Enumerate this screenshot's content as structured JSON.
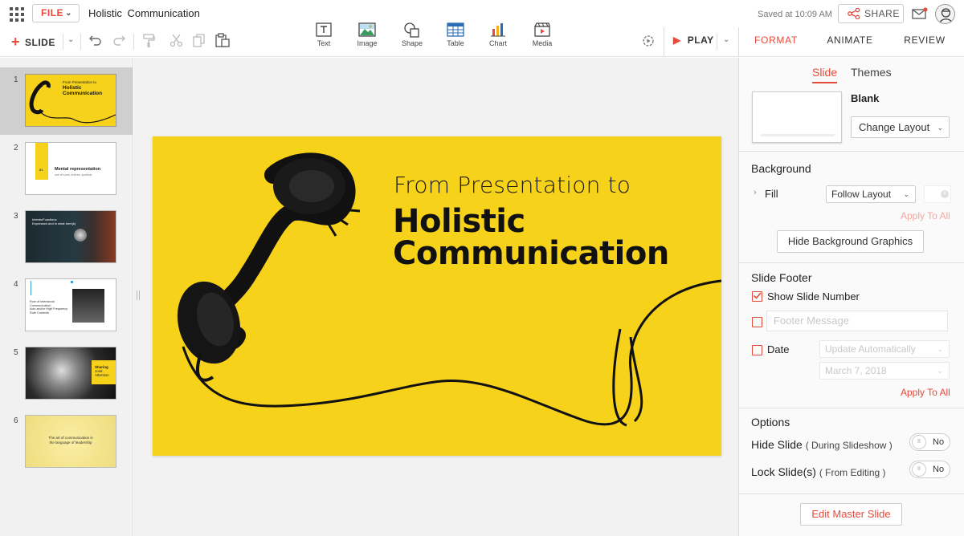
{
  "topbar": {
    "file_label": "FILE",
    "document_title": "Holistic  Communication",
    "saved_status": "Saved at 10:09 AM",
    "share_label": "SHARE"
  },
  "toolbar": {
    "slide_label": "SLIDE",
    "insert_items": [
      {
        "label": "Text",
        "icon": "text-box-icon"
      },
      {
        "label": "Image",
        "icon": "image-icon"
      },
      {
        "label": "Shape",
        "icon": "shape-icon"
      },
      {
        "label": "Table",
        "icon": "table-icon"
      },
      {
        "label": "Chart",
        "icon": "bar-chart-icon"
      },
      {
        "label": "Media",
        "icon": "media-icon"
      }
    ],
    "play_label": "PLAY"
  },
  "right_tabs": [
    {
      "label": "FORMAT",
      "active": true
    },
    {
      "label": "ANIMATE",
      "active": false
    },
    {
      "label": "REVIEW",
      "active": false
    }
  ],
  "colors": {
    "accent": "#e64a3b",
    "slide_bg": "#f7d21a",
    "disabled_link": "#f2a79e"
  },
  "thumbnails": [
    {
      "number": "1",
      "line1": "From Presentation to",
      "line2": "Holistic",
      "line3": "Communication"
    },
    {
      "number": "2",
      "badge": "01",
      "heading": "Mental representation",
      "sub": "use of icons, indices, symbols"
    },
    {
      "number": "3",
      "line1": "Intents/Functions",
      "line2": "Expressed and in what form(s)"
    },
    {
      "number": "4",
      "line1": "Role of Intentional",
      "line2": "Communication",
      "line3": "Acts and/or High Frequency",
      "line4": "Rote Contexts"
    },
    {
      "number": "5",
      "line1": "Sharing",
      "line2": "Joint",
      "line3": "Attention"
    },
    {
      "number": "6",
      "line1": "The art of communication is",
      "line2": "the language of leadership"
    }
  ],
  "slide": {
    "subtitle": "From Presentation to",
    "title_line1": "Holistic",
    "title_line2": "Communication"
  },
  "format_panel": {
    "subtabs": [
      "Slide",
      "Themes"
    ],
    "layout_name": "Blank",
    "change_layout_label": "Change Layout",
    "background": {
      "heading": "Background",
      "fill_label": "Fill",
      "fill_value": "Follow Layout",
      "apply_to_all": "Apply To All",
      "hide_bg_graphics": "Hide Background Graphics"
    },
    "footer": {
      "heading": "Slide Footer",
      "show_slide_number": "Show Slide Number",
      "show_slide_number_checked": true,
      "footer_message_placeholder": "Footer Message",
      "footer_message_checked": false,
      "date_label": "Date",
      "date_checked": false,
      "date_mode": "Update Automatically",
      "date_value": "March 7, 2018",
      "apply_to_all": "Apply To All"
    },
    "options": {
      "heading": "Options",
      "hide_slide_label": "Hide Slide",
      "hide_slide_hint": "( During Slideshow )",
      "hide_slide_value": "No",
      "lock_slide_label": "Lock Slide(s)",
      "lock_slide_hint": "( From Editing )",
      "lock_slide_value": "No",
      "toggle_knob": "II"
    },
    "edit_master_label": "Edit Master Slide"
  }
}
